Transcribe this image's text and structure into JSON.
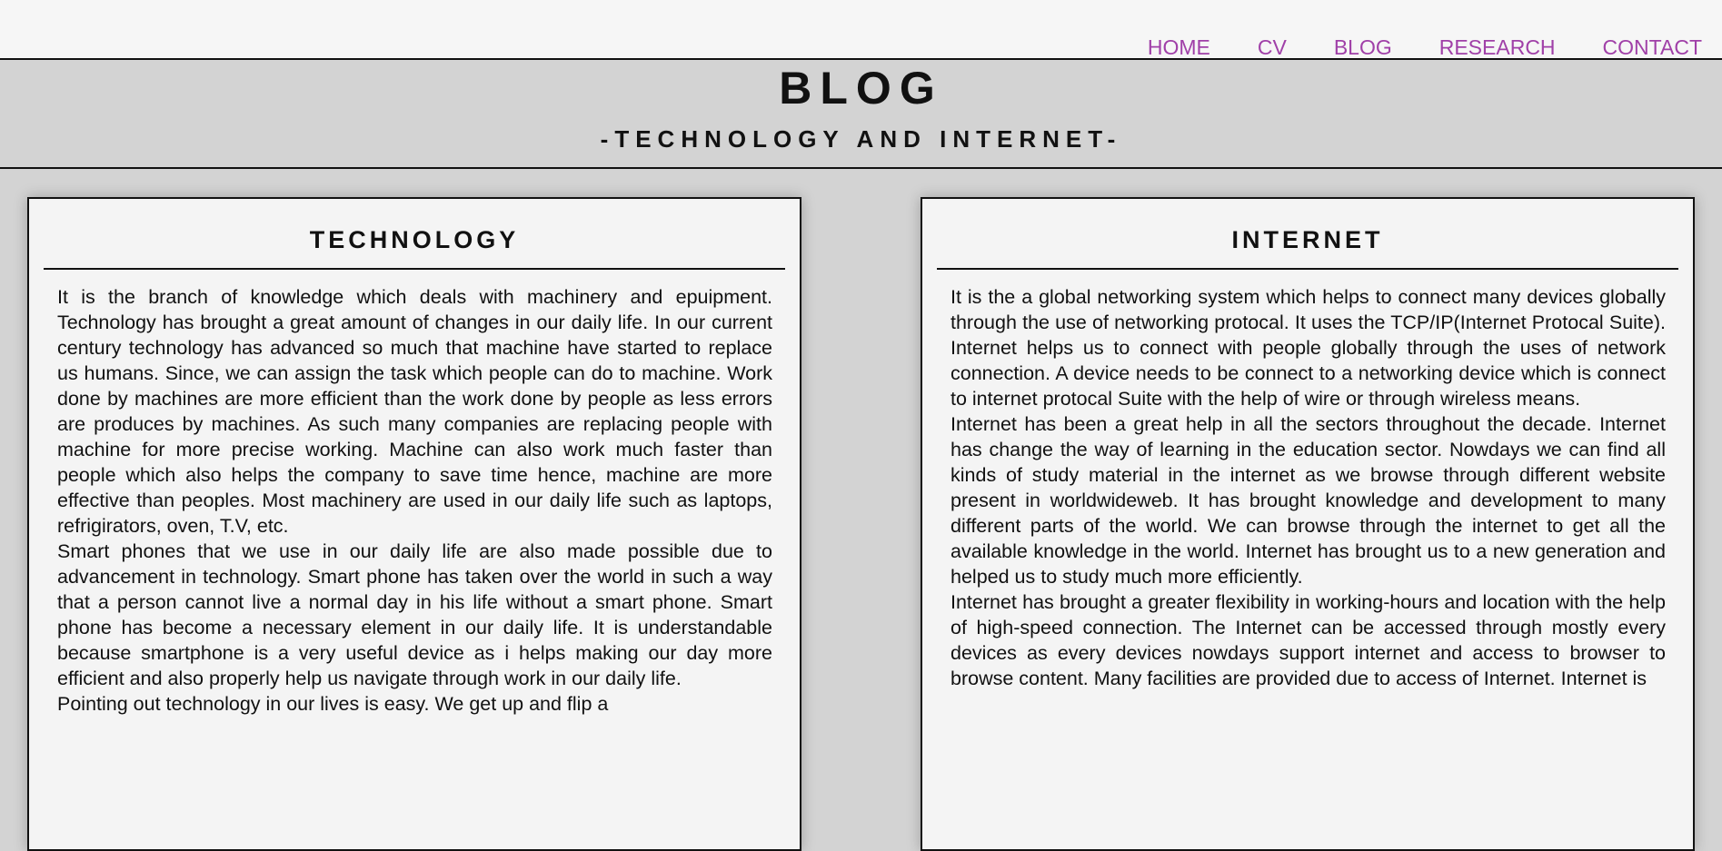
{
  "nav": {
    "items": [
      "HOME",
      "CV",
      "BLOG",
      "RESEARCH",
      "CONTACT"
    ]
  },
  "header": {
    "title": "BLOG",
    "subtitle": "-TECHNOLOGY AND INTERNET-"
  },
  "cards": [
    {
      "heading": "TECHNOLOGY",
      "paragraphs": [
        "It is the branch of knowledge which deals with machinery and epuipment. Technology has brought a great amount of changes in our daily life. In our current century technology has advanced so much that machine have started to replace us humans. Since, we can assign the task which people can do to machine. Work done by machines are more efficient than the work done by people as less errors are produces by machines. As such many companies are replacing people with machine for more precise working. Machine can also work much faster than people which also helps the company to save time hence, machine are more effective than peoples. Most machinery are used in our daily life such as laptops, refrigirators, oven, T.V, etc.",
        "Smart phones that we use in our daily life are also made possible due to advancement in technology. Smart phone has taken over the world in such a way that a person cannot live a normal day in his life without a smart phone. Smart phone has become a necessary element in our daily life. It is understandable because smartphone is a very useful device as i helps making our day more efficient and also properly help us navigate through work in our daily life.",
        "Pointing out technology in our lives is easy. We get up and flip a"
      ]
    },
    {
      "heading": "INTERNET",
      "paragraphs": [
        "It is the a global networking system which helps to connect many devices globally through the use of networking protocal. It uses the TCP/IP(Internet Protocal Suite). Internet helps us to connect with people globally through the uses of network connection. A device needs to be connect to a networking device which is connect to internet protocal Suite with the help of wire or through wireless means.",
        "Internet has been a great help in all the sectors throughout the decade. Internet has change the way of learning in the education sector. Nowdays we can find all kinds of study material in the internet as we browse through different website present in worldwideweb. It has brought knowledge and development to many different parts of the world. We can browse through the internet to get all the available knowledge in the world. Internet has brought us to a new generation and helped us to study much more efficiently.",
        "Internet has brought a greater flexibility in working-hours and location with the help of high-speed connection. The Internet can be accessed through mostly every devices as every devices nowdays support internet and access to browser to browse content. Many facilities are provided due to access of Internet. Internet is"
      ]
    }
  ],
  "colors": {
    "nav_link": "#a040a8",
    "background": "#d3d3d3",
    "card_background": "#f4f4f4"
  }
}
